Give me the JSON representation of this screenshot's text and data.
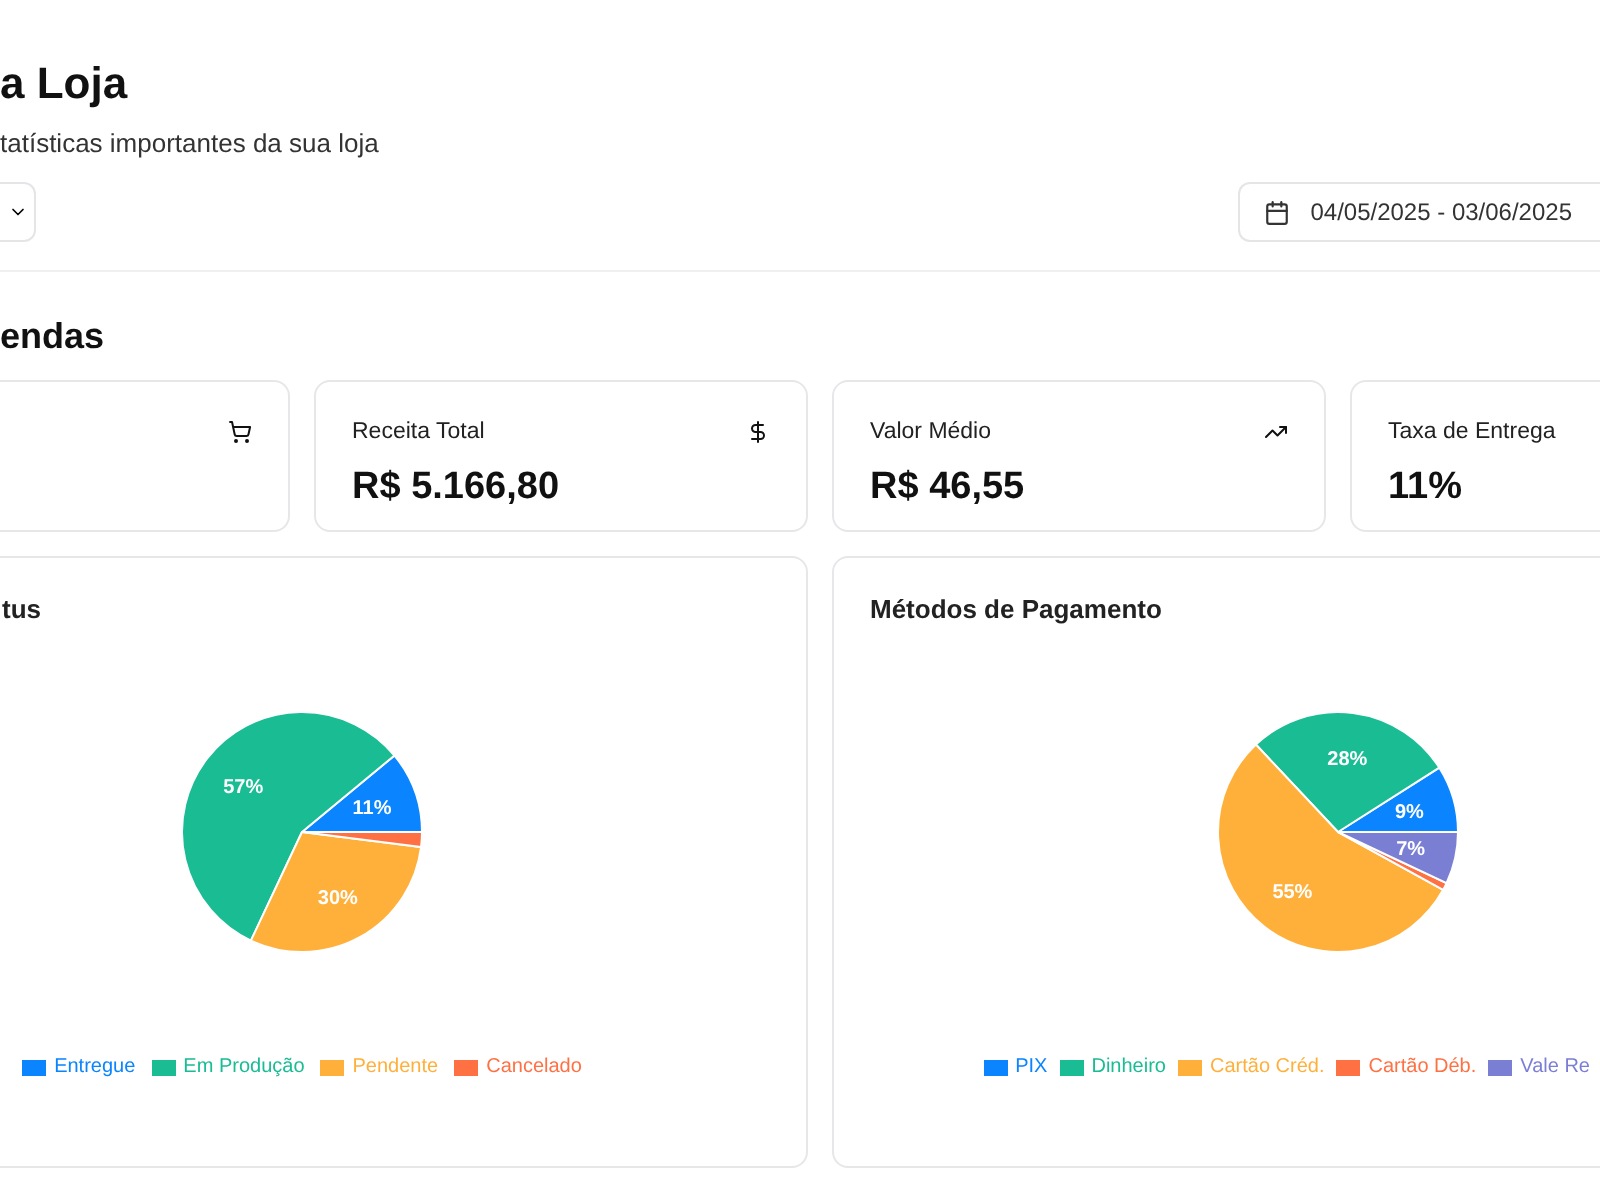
{
  "header": {
    "title": "a Loja",
    "subtitle": "tatísticas importantes da sua loja",
    "date_range": "04/05/2025 - 03/06/2025"
  },
  "section_title": "endas",
  "stats": [
    {
      "kind": "blank"
    },
    {
      "kind": "metric",
      "label": "Receita Total",
      "value": "R$ 5.166,80"
    },
    {
      "kind": "metric",
      "label": "Valor Médio",
      "value": "R$ 46,55"
    },
    {
      "kind": "metric",
      "label": "Taxa de Entrega",
      "value": "11%"
    }
  ],
  "charts": [
    {
      "title": "tus",
      "chart_data": {
        "type": "pie",
        "categories": [
          "Entregue",
          "Em Produção",
          "Pendente",
          "Cancelado"
        ],
        "values": [
          11,
          57,
          30,
          2
        ],
        "colors": [
          "#0a84ff",
          "#1abc94",
          "#ffb03b",
          "#ff7043"
        ],
        "annotations": [
          {
            "x": "Entregue",
            "text": "11%"
          },
          {
            "x": "Em Produção",
            "text": "57%"
          },
          {
            "x": "Pendente",
            "text": "30%"
          }
        ]
      }
    },
    {
      "title": "Métodos de Pagamento",
      "chart_data": {
        "type": "pie",
        "categories": [
          "PIX",
          "Dinheiro",
          "Cartão Créd.",
          "Cartão Déb.",
          "Vale Re"
        ],
        "values": [
          9,
          28,
          55,
          1,
          7
        ],
        "colors": [
          "#0a84ff",
          "#1abc94",
          "#ffb03b",
          "#ff7043",
          "#7b7fd4"
        ],
        "annotations": [
          {
            "x": "PIX",
            "text": "9%"
          },
          {
            "x": "Dinheiro",
            "text": "28%"
          },
          {
            "x": "Cartão Créd.",
            "text": "55%"
          },
          {
            "x": "Vale Re",
            "text": "7%"
          }
        ]
      }
    }
  ]
}
